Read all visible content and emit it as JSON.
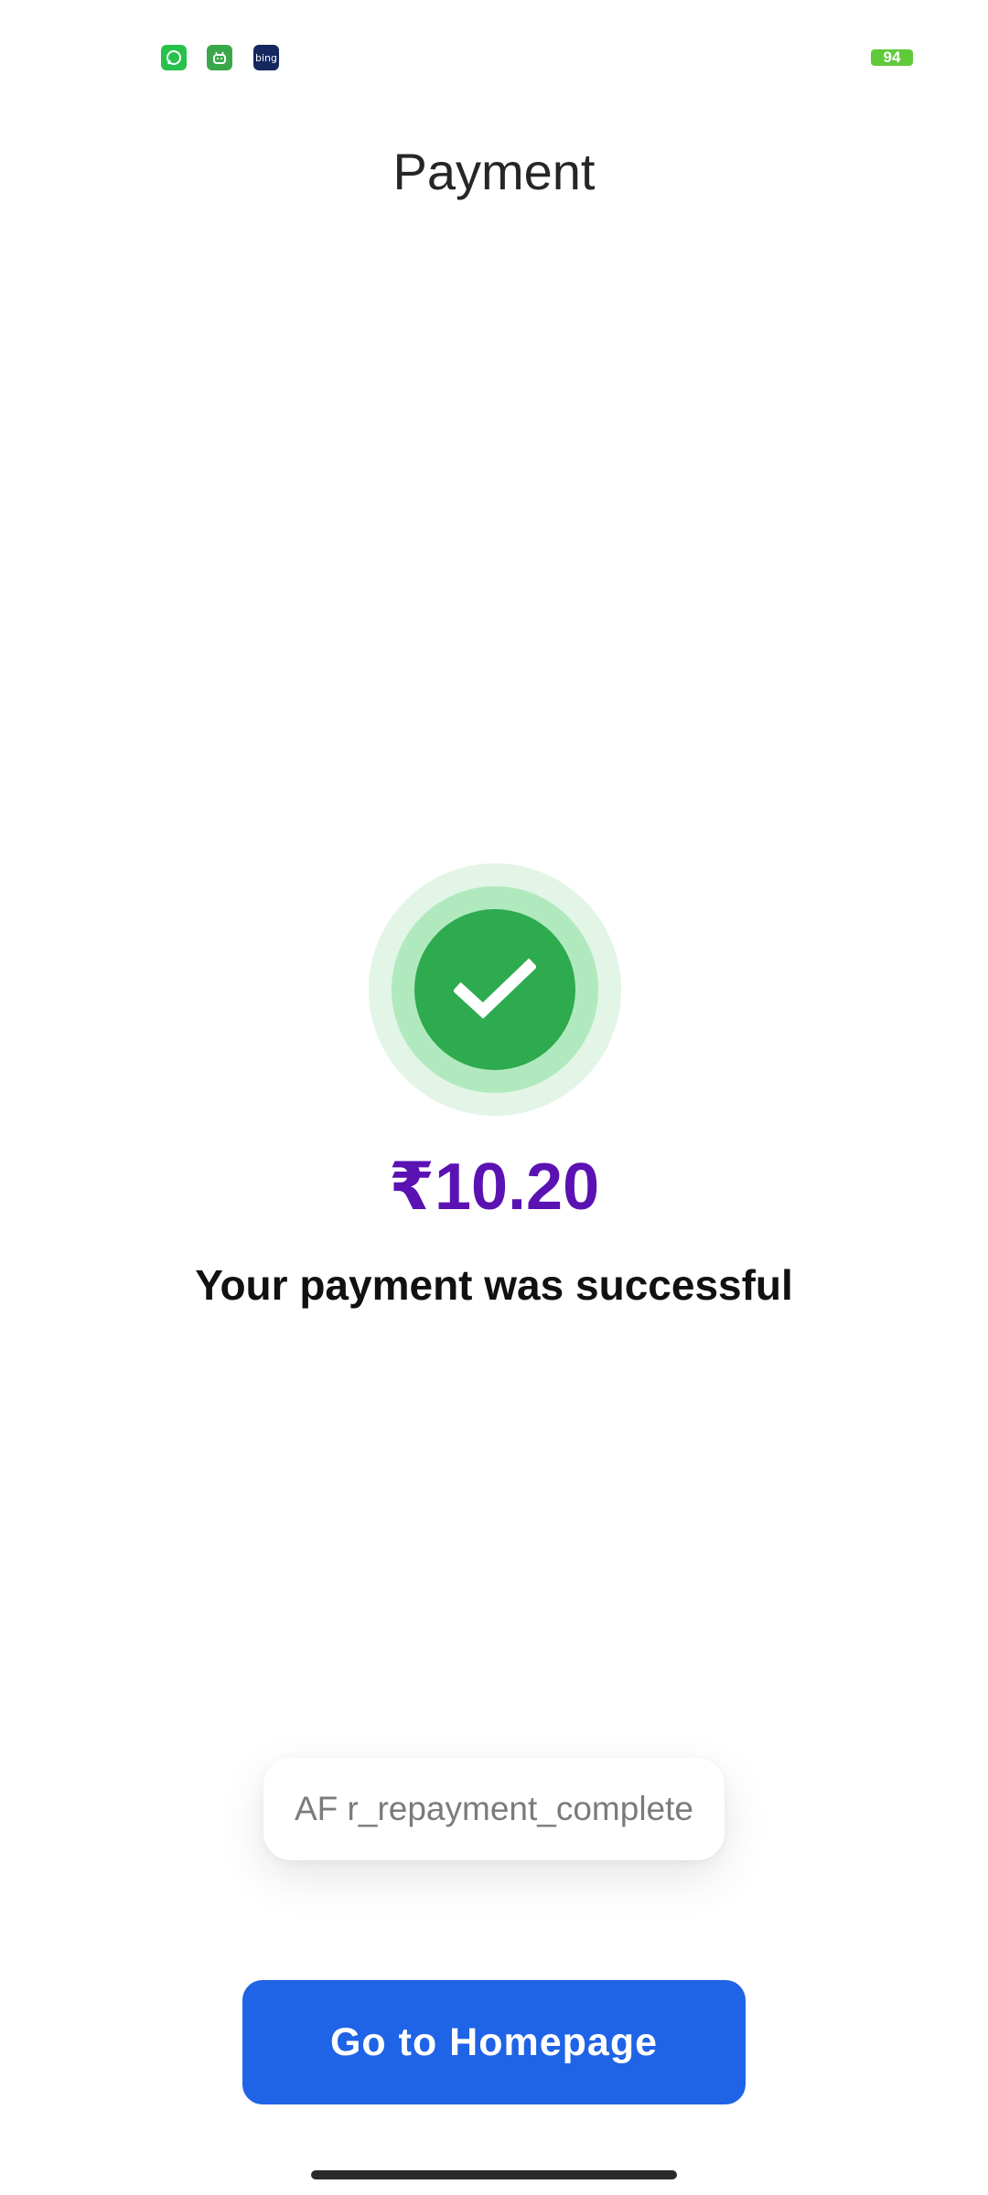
{
  "status_bar": {
    "icons": [
      "whatsapp-icon",
      "android-icon",
      "bing-icon"
    ],
    "bing_label": "bing",
    "battery_level": "94",
    "battery_color": "#5fcb3b"
  },
  "header": {
    "title": "Payment"
  },
  "result": {
    "status_icon": "check-icon",
    "amount": "₹10.20",
    "message": "Your payment was successful",
    "colors": {
      "success_green": "#2eaa4f",
      "amount_purple": "#5a12b3"
    }
  },
  "toast": {
    "text": "AF r_repayment_complete"
  },
  "actions": {
    "home_button_label": "Go to Homepage",
    "button_color": "#1f63e6"
  }
}
